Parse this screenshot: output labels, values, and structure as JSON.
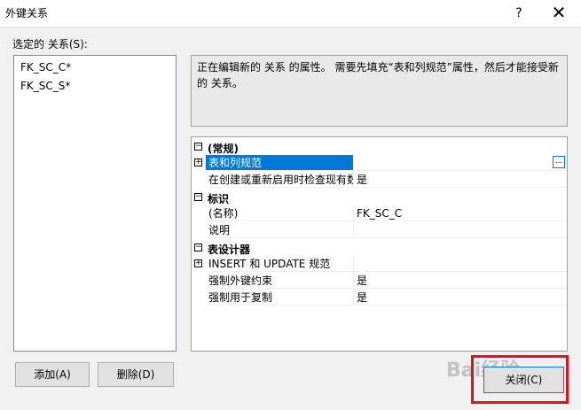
{
  "window": {
    "title": "外键关系",
    "help": "?",
    "close": "✕"
  },
  "relationships": {
    "label": "选定的 关系(S):",
    "items": [
      "FK_SC_C*",
      "FK_SC_S*"
    ]
  },
  "description": "正在编辑新的 关系 的属性。   需要先填充“表和列规范”属性，然后才能接受新的 关系。",
  "grid": {
    "cat_general": "(常规)",
    "table_col_spec": "表和列规范",
    "check_existing": "在创建或重新启用时检查现有数据",
    "check_existing_value": "是",
    "cat_identity": "标识",
    "name_label": "(名称)",
    "name_value": "FK_SC_C",
    "desc_label": "说明",
    "cat_designer": "表设计器",
    "insert_update": "INSERT 和 UPDATE 规范",
    "enforce_fk": "强制外键约束",
    "enforce_fk_value": "是",
    "enforce_repl": "强制用于复制",
    "enforce_repl_value": "是",
    "ellipsis": "..."
  },
  "buttons": {
    "add": "添加(A)",
    "delete": "删除(D)",
    "close": "关闭(C)"
  },
  "watermark": "Bai经验"
}
